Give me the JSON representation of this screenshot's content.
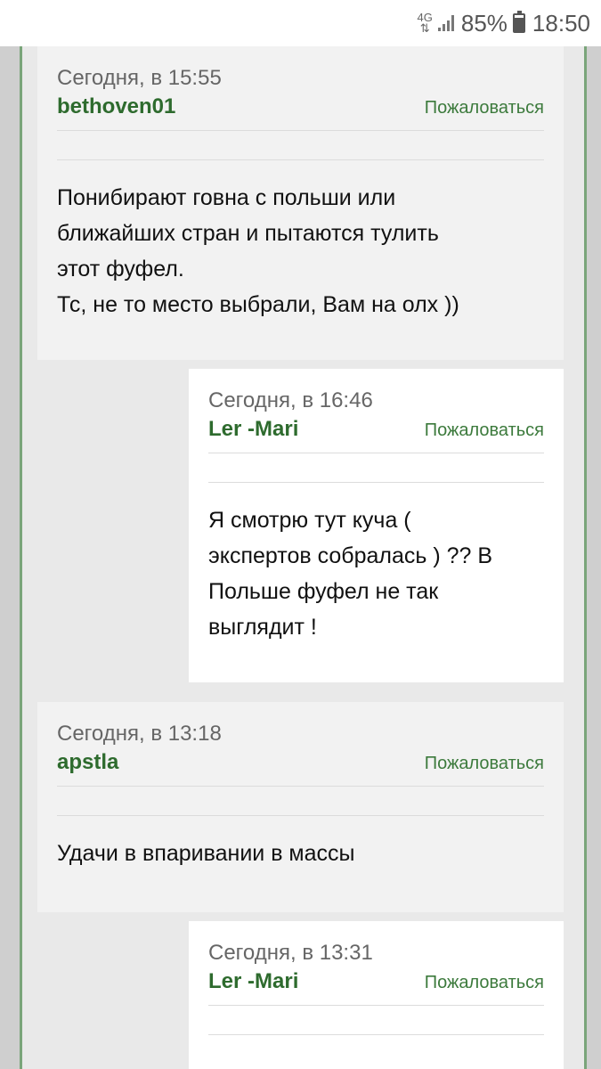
{
  "status_bar": {
    "network": "4G",
    "battery_percent": "85%",
    "battery_level": 0.85,
    "time": "18:50",
    "icons": [
      "network-4g-icon",
      "signal-icon",
      "battery-icon"
    ]
  },
  "colors": {
    "username": "#2e6b2e",
    "report_link": "#3c7a3c",
    "page_border": "#7aa57a"
  },
  "comments": [
    {
      "date": "Сегодня, в 15:55",
      "user": "bethoven01",
      "report": "Пожаловаться",
      "text": "Понибирают говна с польши или\nближайших стран и пытаются тулить\nэтот фуфел.\nТс, не то место выбрали, Вам на олх ))"
    },
    {
      "date": "Сегодня, в 16:46",
      "user": "Ler -Mari",
      "report": "Пожаловаться",
      "text": "Я смотрю тут куча (\nэкспертов собралась ) ?? В\nПольше фуфел не так\nвыглядит !"
    },
    {
      "date": "Сегодня, в 13:18",
      "user": "apstla",
      "report": "Пожаловаться",
      "text": "Удачи в впаривании в массы"
    },
    {
      "date": "Сегодня, в 13:31",
      "user": "Ler -Mari",
      "report": "Пожаловаться",
      "text": ""
    }
  ]
}
